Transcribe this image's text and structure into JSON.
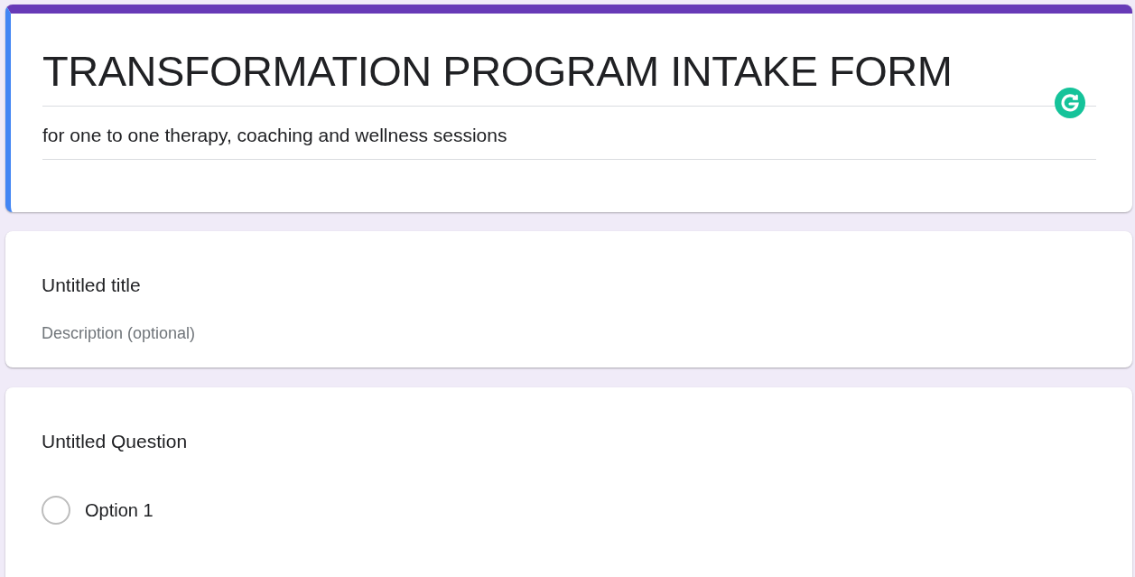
{
  "form": {
    "title": "TRANSFORMATION PROGRAM INTAKE FORM",
    "description": "for one to one therapy, coaching and wellness sessions"
  },
  "section": {
    "title": "Untitled title",
    "description_placeholder": "Description (optional)"
  },
  "question": {
    "title": "Untitled Question",
    "options": [
      {
        "label": "Option 1",
        "selected": false
      }
    ]
  }
}
